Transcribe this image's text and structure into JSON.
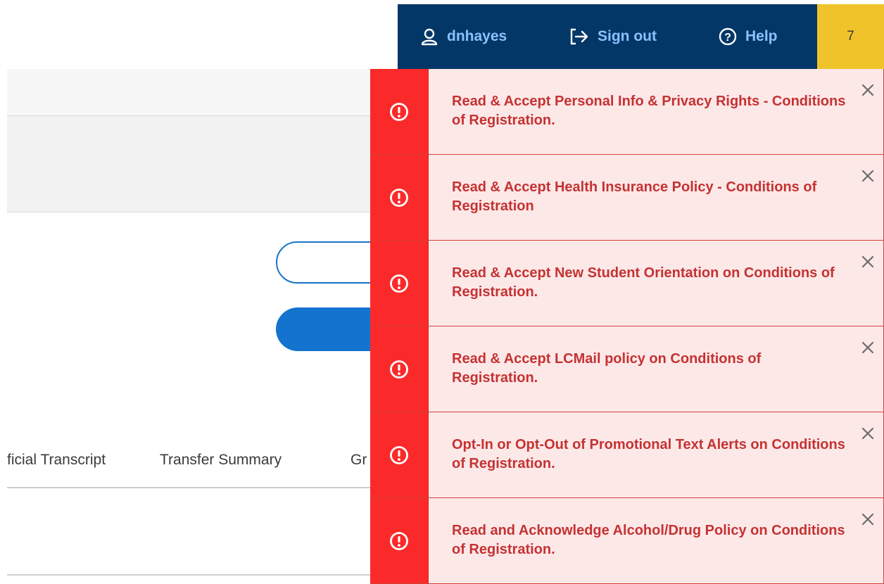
{
  "header": {
    "username": "dnhayes",
    "signout_label": "Sign out",
    "help_label": "Help",
    "notification_count": "7",
    "colors": {
      "bar": "#033767",
      "link": "#8ac1ff",
      "badge": "#f0c32b"
    }
  },
  "background": {
    "tabs": [
      "ficial Transcript",
      "Transfer Summary",
      "Gr"
    ]
  },
  "alerts": [
    {
      "text": "Read & Accept Personal Info & Privacy Rights - Conditions of Registration."
    },
    {
      "text": "Read & Accept Health Insurance Policy - Conditions of Registration"
    },
    {
      "text": "Read & Accept New Student Orientation on Conditions of Registration."
    },
    {
      "text": "Read & Accept LCMail policy on Conditions of Registration."
    },
    {
      "text": "Opt-In or Opt-Out of Promotional Text Alerts on Conditions of Registration."
    },
    {
      "text": "Read and Acknowledge Alcohol/Drug Policy on Conditions of Registration."
    }
  ],
  "icons": {
    "alert": "exclamation-circle-icon",
    "close": "close-icon",
    "user": "user-icon",
    "signout": "sign-out-icon",
    "help": "question-circle-icon"
  }
}
